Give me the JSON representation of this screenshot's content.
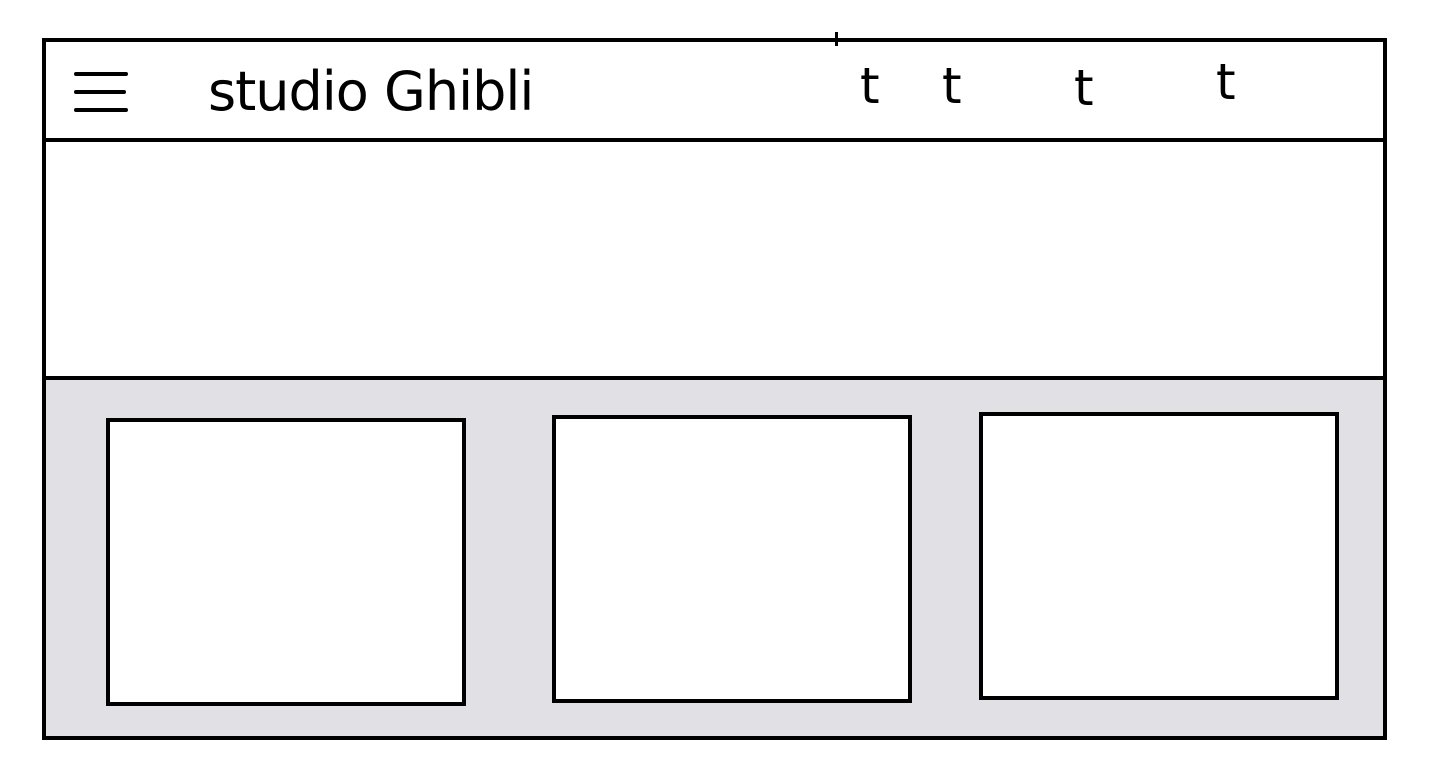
{
  "header": {
    "menu_icon": "hamburger-menu-icon",
    "brand": "studio Ghibli",
    "nav_links": [
      "t",
      "t",
      "t",
      "t"
    ]
  },
  "colors": {
    "stroke": "#000000",
    "background": "#ffffff",
    "cards_area": "#e1e0e4"
  }
}
